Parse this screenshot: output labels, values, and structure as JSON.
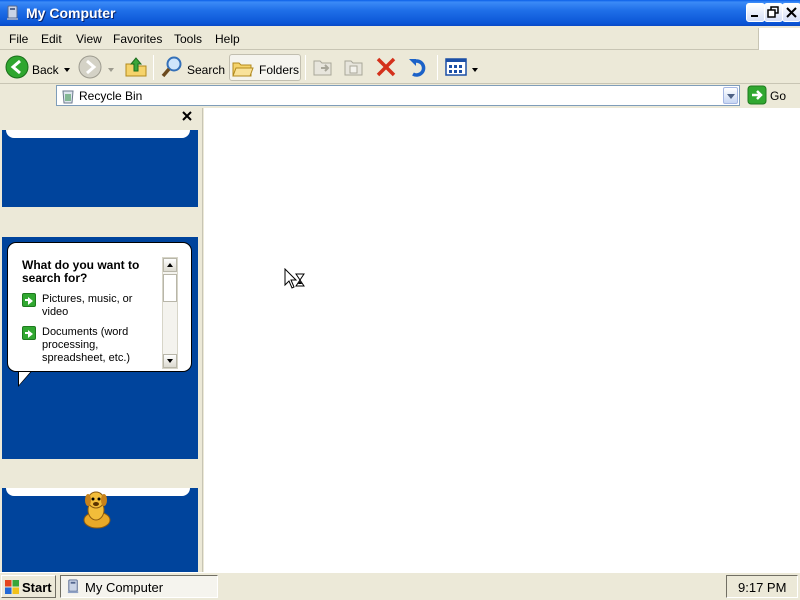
{
  "window": {
    "title": "My Computer"
  },
  "menu": [
    "File",
    "Edit",
    "View",
    "Favorites",
    "Tools",
    "Help"
  ],
  "toolbar": {
    "back_label": "Back",
    "search_label": "Search",
    "folders_label": "Folders"
  },
  "address": {
    "value": "Recycle Bin",
    "go_label": "Go"
  },
  "assistant": {
    "heading": "What do you want to search for?",
    "options": [
      "Pictures, music, or video",
      "Documents (word processing, spreadsheet, etc.)"
    ]
  },
  "taskbar": {
    "start_label": "Start",
    "task_label": "My Computer",
    "clock": "9:17 PM"
  },
  "colors": {
    "titlebar": "#0b55d6",
    "pane_blue": "#00449c",
    "content_bg": "#ffffff",
    "chrome_bg": "#ece9d8"
  }
}
